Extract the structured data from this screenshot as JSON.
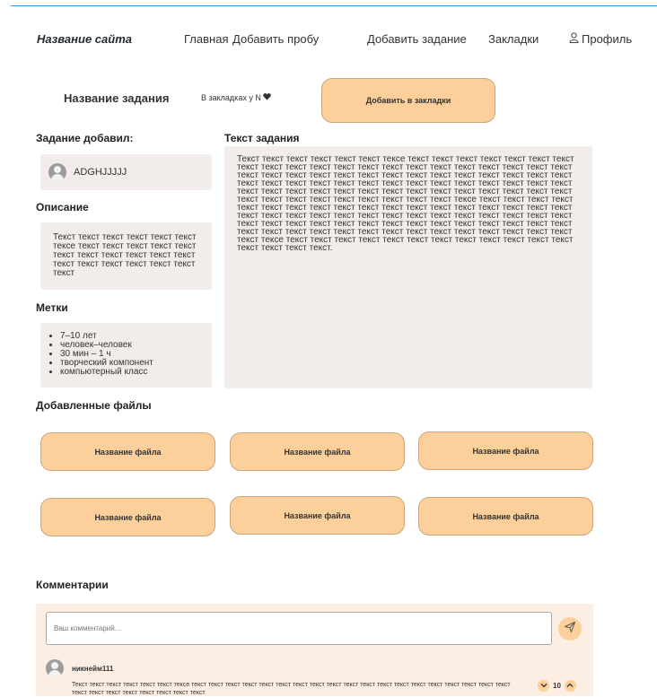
{
  "header": {
    "site_title": "Название сайта",
    "nav": {
      "home": "Главная",
      "add_test": "Добавить пробу",
      "add_task": "Добавить задание",
      "bookmarks": "Закладки",
      "profile": "Профиль"
    }
  },
  "task": {
    "title": "Название задания",
    "bookmarked_text": "В закладках у N",
    "add_bookmark_label": "Добавить в закладки",
    "author_heading": "Задание добавил:",
    "author_name": "ADGHJJJJJ",
    "description_heading": "Описание",
    "description": "Текст текст текст текст текст текст тексе текст текст текст текст текст текст текст текст текст текст текст текст текст текст текст текст текст текст",
    "tags_heading": "Метки",
    "tags": [
      "7–10 лет",
      "человек–человек",
      "30 мин – 1 ч",
      "творческий компонент",
      "компьютерный класс"
    ],
    "text_heading": "Текст задания",
    "text": "Текст текст текст текст текст текст тексе текст текст текст текст текст текст текст текст текст текст текст текст текст текст текст текст текст текст текст текст текст текст текст текст текст текст текст текст текст текст текст текст текст текст текст текст текст текст текст текст текст текст текст текст текст текст текст текст текст текст текст текст текст текст текст текст текст текст текст текст текст текст текст текст текст текст текст текст текст текст текст текст тексе текст текст текст текст текст текст текст текст текст текст текст текст текст текст текст текст текст текст текст текст текст текст текст текст текст текст текст текст текст текст текст текст текст текст текст текст текст текст текст текст текст текст текст текст текст текст текст текст текст текст текст текст текст текст текст текст текст текст текст текст текст тексе текст текст текст текст текст текст текст текст текст текст текст текст текст текст текст текст."
  },
  "files": {
    "heading": "Добавленные файлы",
    "items": [
      "Название файла",
      "Название файла",
      "Название файла",
      "Название файла",
      "Название файла",
      "Название файла"
    ]
  },
  "comments": {
    "heading": "Комментарии",
    "input_placeholder": "Ваш комментарий...",
    "items": [
      {
        "nickname": "никнейм111",
        "text": "Текст текст текст текст текст текст тексе текст текст текст текст текст текст текст текст текст текст текст текст текст текст текст текст текст текст текст текст текст текст текст текст текст текст текст",
        "votes": "10"
      }
    ]
  },
  "colors": {
    "accent": "#fdd09b",
    "panel": "#f2eceb",
    "comment_bg": "#fceee3",
    "top_line": "#3b8fd8"
  }
}
